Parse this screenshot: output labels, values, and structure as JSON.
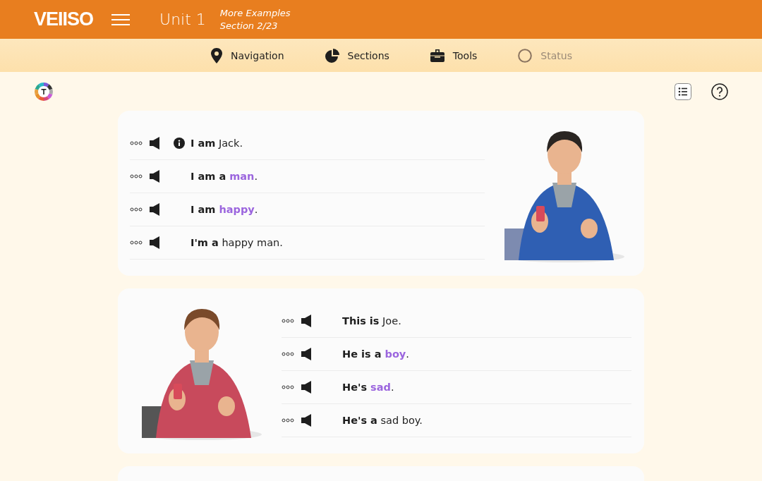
{
  "header": {
    "logo": "VEIISO",
    "unit": "Unit 1",
    "subtitle": "More Examples",
    "section": "Section 2/23"
  },
  "nav": [
    {
      "label": "Navigation",
      "disabled": false
    },
    {
      "label": "Sections",
      "disabled": false
    },
    {
      "label": "Tools",
      "disabled": false
    },
    {
      "label": "Status",
      "disabled": true
    }
  ],
  "cards": [
    {
      "sentences": [
        {
          "info": true,
          "parts": [
            {
              "text": "I am",
              "kind": "bold"
            },
            {
              "text": " Jack.",
              "kind": "plain"
            }
          ]
        },
        {
          "info": false,
          "parts": [
            {
              "text": "I am a ",
              "kind": "bold"
            },
            {
              "text": "man",
              "kind": "highlight"
            },
            {
              "text": ".",
              "kind": "plain"
            }
          ]
        },
        {
          "info": false,
          "parts": [
            {
              "text": "I am ",
              "kind": "bold"
            },
            {
              "text": "happy",
              "kind": "highlight"
            },
            {
              "text": ".",
              "kind": "plain"
            }
          ]
        },
        {
          "info": false,
          "parts": [
            {
              "text": "I'm a",
              "kind": "bold"
            },
            {
              "text": " happy man.",
              "kind": "plain"
            }
          ]
        }
      ]
    },
    {
      "sentences": [
        {
          "info": false,
          "parts": [
            {
              "text": "This is",
              "kind": "bold"
            },
            {
              "text": " Joe.",
              "kind": "plain"
            }
          ]
        },
        {
          "info": false,
          "parts": [
            {
              "text": "He is a ",
              "kind": "bold"
            },
            {
              "text": "boy",
              "kind": "highlight"
            },
            {
              "text": ".",
              "kind": "plain"
            }
          ]
        },
        {
          "info": false,
          "parts": [
            {
              "text": "He's ",
              "kind": "bold"
            },
            {
              "text": "sad",
              "kind": "highlight"
            },
            {
              "text": ".",
              "kind": "plain"
            }
          ]
        },
        {
          "info": false,
          "parts": [
            {
              "text": "He's a",
              "kind": "bold"
            },
            {
              "text": " sad boy.",
              "kind": "plain"
            }
          ]
        }
      ]
    }
  ]
}
